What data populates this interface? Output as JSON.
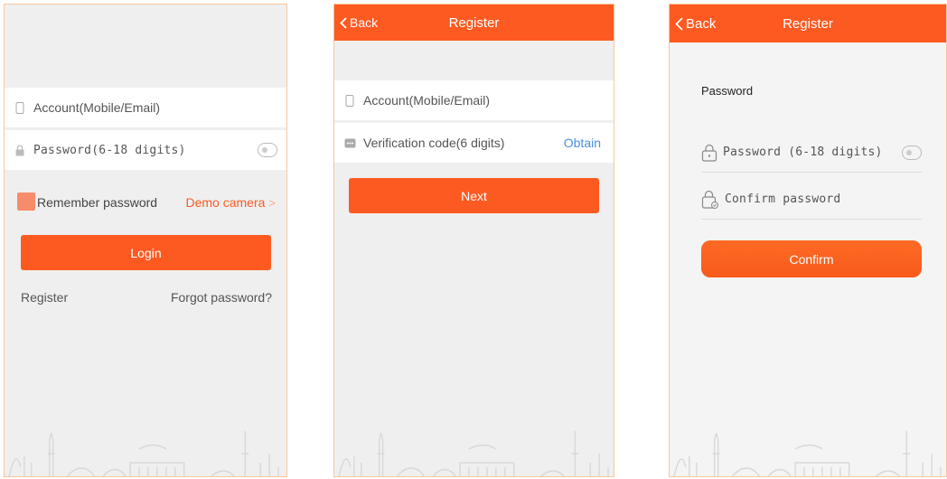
{
  "login": {
    "account_placeholder": "Account(Mobile/Email)",
    "password_placeholder": "Password(6-18 digits)",
    "remember_label": "Remember password",
    "demo_label": "Demo camera",
    "demo_chevron": ">",
    "login_button": "Login",
    "register_link": "Register",
    "forgot_link": "Forgot password?"
  },
  "register_step1": {
    "back_label": "Back",
    "title": "Register",
    "account_placeholder": "Account(Mobile/Email)",
    "code_placeholder": "Verification code(6 digits)",
    "obtain_label": "Obtain",
    "next_button": "Next"
  },
  "register_step2": {
    "back_label": "Back",
    "title": "Register",
    "section_label": "Password",
    "password_placeholder": "Password (6-18 digits)",
    "confirm_placeholder": "Confirm password",
    "confirm_button": "Confirm"
  },
  "colors": {
    "accent": "#fd5a22",
    "link_blue": "#4a8fe0",
    "border": "#f8c79b"
  },
  "icons": [
    "phone-icon",
    "lock-icon",
    "eye-toggle-icon",
    "chevron-left-icon",
    "chevron-right-icon",
    "chat-bubble-icon",
    "lock-confirm-icon",
    "skyline-decoration"
  ]
}
